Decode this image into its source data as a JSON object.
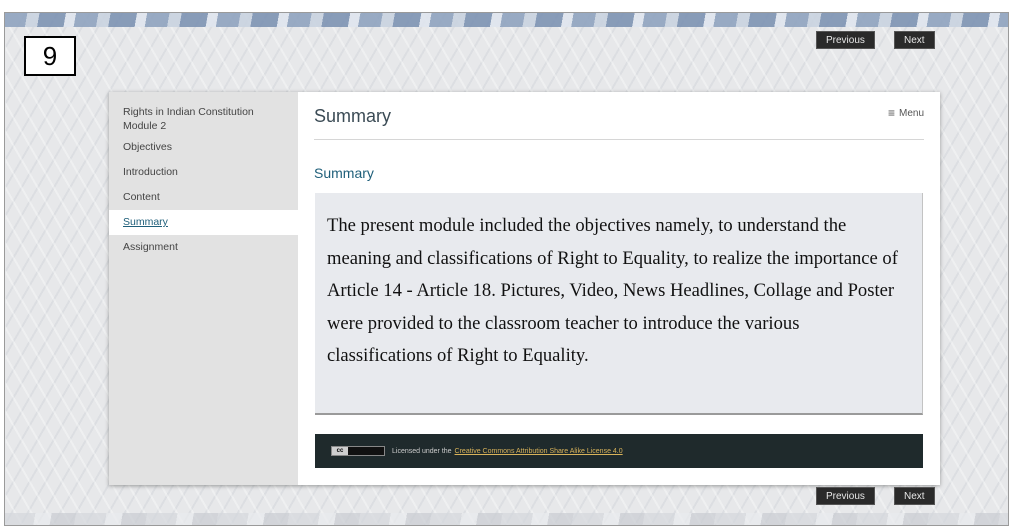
{
  "page_number": "9",
  "nav": {
    "previous_label": "Previous",
    "next_label": "Next"
  },
  "sidebar": {
    "title_line1": "Rights in Indian Constitution",
    "title_line2": "Module 2",
    "items": [
      {
        "label": "Objectives"
      },
      {
        "label": "Introduction"
      },
      {
        "label": "Content"
      },
      {
        "label": "Summary"
      },
      {
        "label": "Assignment"
      }
    ]
  },
  "main": {
    "title": "Summary",
    "menu_label": "Menu",
    "section_heading": "Summary",
    "summary_text": "The present module included the objectives namely, to understand the meaning and classifications of Right to Equality, to realize the importance of Article 14 - Article 18. Pictures, Video, News Headlines, Collage and Poster were provided to the classroom teacher to introduce the various classifications of Right to Equality."
  },
  "footer": {
    "license_prefix": "Licensed under the",
    "license_link": "Creative Commons Attribution Share Alike License 4.0"
  },
  "icons": {
    "menu": "hamburger-icon",
    "license": "cc-by-sa-icon"
  },
  "colors": {
    "accent": "#1f5f7a",
    "footer_bg": "#1f2a2c",
    "link": "#d9b35a",
    "button_bg": "#2a2a2a"
  }
}
